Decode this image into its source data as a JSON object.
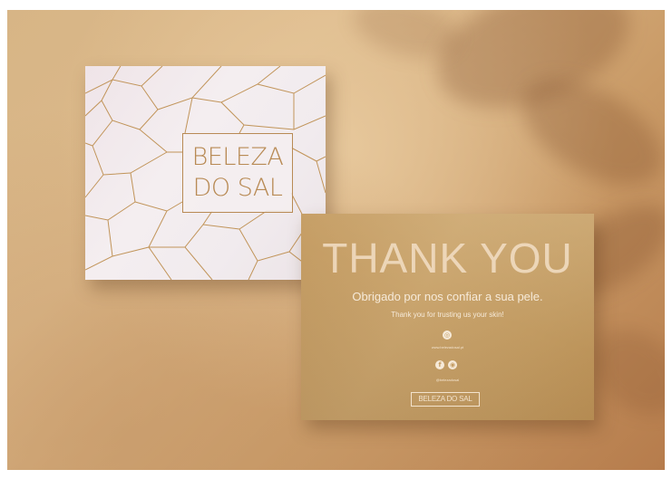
{
  "brand": {
    "line1": "BELEZA",
    "line2": "DO SAL",
    "mini_logo": "BELEZA DO SAL"
  },
  "back_card": {
    "heading": "THANK YOU",
    "message_pt": "Obrigado por nos confiar a sua pele.",
    "message_en": "Thank you for trusting us your skin!",
    "website": "www.belezadosal.pt",
    "social_handle": "@belezadosal"
  },
  "icons": [
    "globe-icon",
    "facebook-icon",
    "instagram-icon"
  ],
  "colors": {
    "background": "#d7b586",
    "card_back": "#c49c63",
    "gold_line": "#b88a54",
    "card_front": "#f1ebee"
  }
}
